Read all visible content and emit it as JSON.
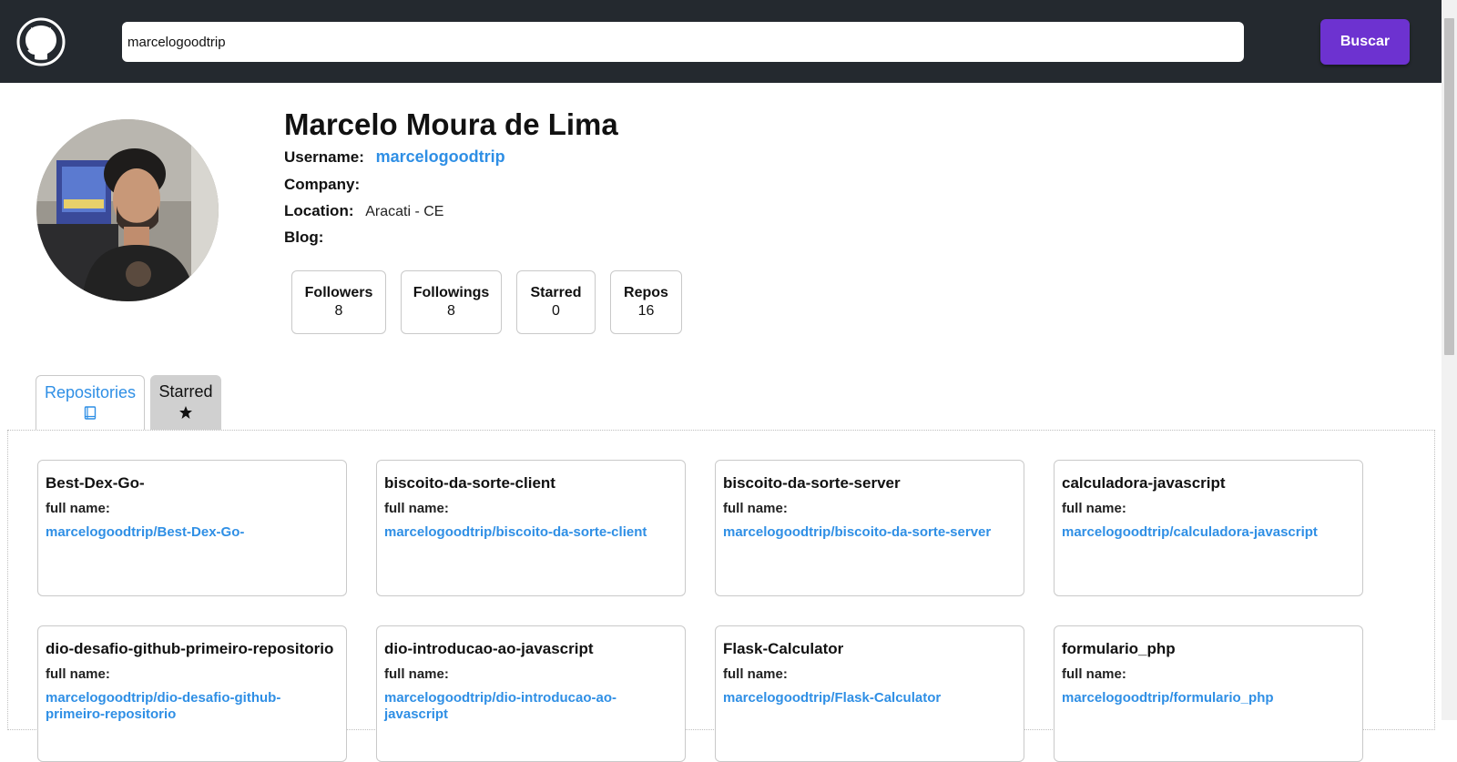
{
  "header": {
    "search_value": "marcelogoodtrip",
    "search_button": "Buscar"
  },
  "profile": {
    "name": "Marcelo Moura de Lima",
    "username_label": "Username:",
    "username": "marcelogoodtrip",
    "company_label": "Company:",
    "company": "",
    "location_label": "Location:",
    "location": "Aracati - CE",
    "blog_label": "Blog:",
    "blog": ""
  },
  "stats": [
    {
      "label": "Followers",
      "value": "8"
    },
    {
      "label": "Followings",
      "value": "8"
    },
    {
      "label": "Starred",
      "value": "0"
    },
    {
      "label": "Repos",
      "value": "16"
    }
  ],
  "tabs": [
    {
      "label": "Repositories",
      "icon": "book-icon"
    },
    {
      "label": "Starred",
      "icon": "star-icon"
    }
  ],
  "repos": [
    {
      "name": "Best-Dex-Go-",
      "full_name_label": "full name:",
      "full_name": "marcelogoodtrip/Best-Dex-Go-"
    },
    {
      "name": "biscoito-da-sorte-client",
      "full_name_label": "full name:",
      "full_name": "marcelogoodtrip/biscoito-da-sorte-client"
    },
    {
      "name": "biscoito-da-sorte-server",
      "full_name_label": "full name:",
      "full_name": "marcelogoodtrip/biscoito-da-sorte-server"
    },
    {
      "name": "calculadora-javascript",
      "full_name_label": "full name:",
      "full_name": "marcelogoodtrip/calculadora-javascript"
    },
    {
      "name": "dio-desafio-github-primeiro-repositorio",
      "full_name_label": "full name:",
      "full_name": "marcelogoodtrip/dio-desafio-github-primeiro-repositorio"
    },
    {
      "name": "dio-introducao-ao-javascript",
      "full_name_label": "full name:",
      "full_name": "marcelogoodtrip/dio-introducao-ao-javascript"
    },
    {
      "name": "Flask-Calculator",
      "full_name_label": "full name:",
      "full_name": "marcelogoodtrip/Flask-Calculator"
    },
    {
      "name": "formulario_php",
      "full_name_label": "full name:",
      "full_name": "marcelogoodtrip/formulario_php"
    }
  ],
  "colors": {
    "topbar": "#24292f",
    "accent_button": "#6d32d0",
    "link": "#2f8fe5"
  }
}
